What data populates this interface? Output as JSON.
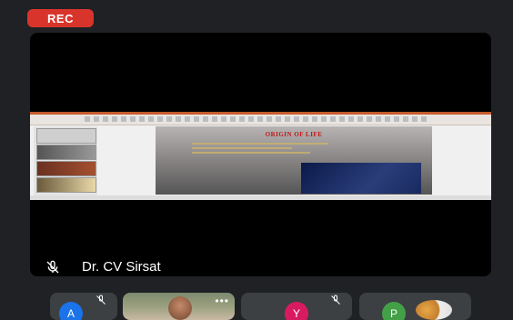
{
  "recording": {
    "label": "REC"
  },
  "main_tile": {
    "presenter_name": "Dr. CV Sirsat",
    "mic_icon": "mic-off-icon",
    "slide": {
      "title": "ORIGIN OF LIFE"
    }
  },
  "participants": [
    {
      "initial": "A",
      "color": "#1a73e8",
      "muted": true
    },
    {
      "initial": "",
      "video": true,
      "menu": "•••"
    },
    {
      "initial": "Y",
      "color": "#d81b60",
      "muted": true
    },
    {
      "initial": "P",
      "color": "#43a047",
      "extra_icon": "brain-icon"
    }
  ],
  "colors": {
    "background": "#202124",
    "tile": "#3c4043",
    "rec": "#d9342b"
  }
}
